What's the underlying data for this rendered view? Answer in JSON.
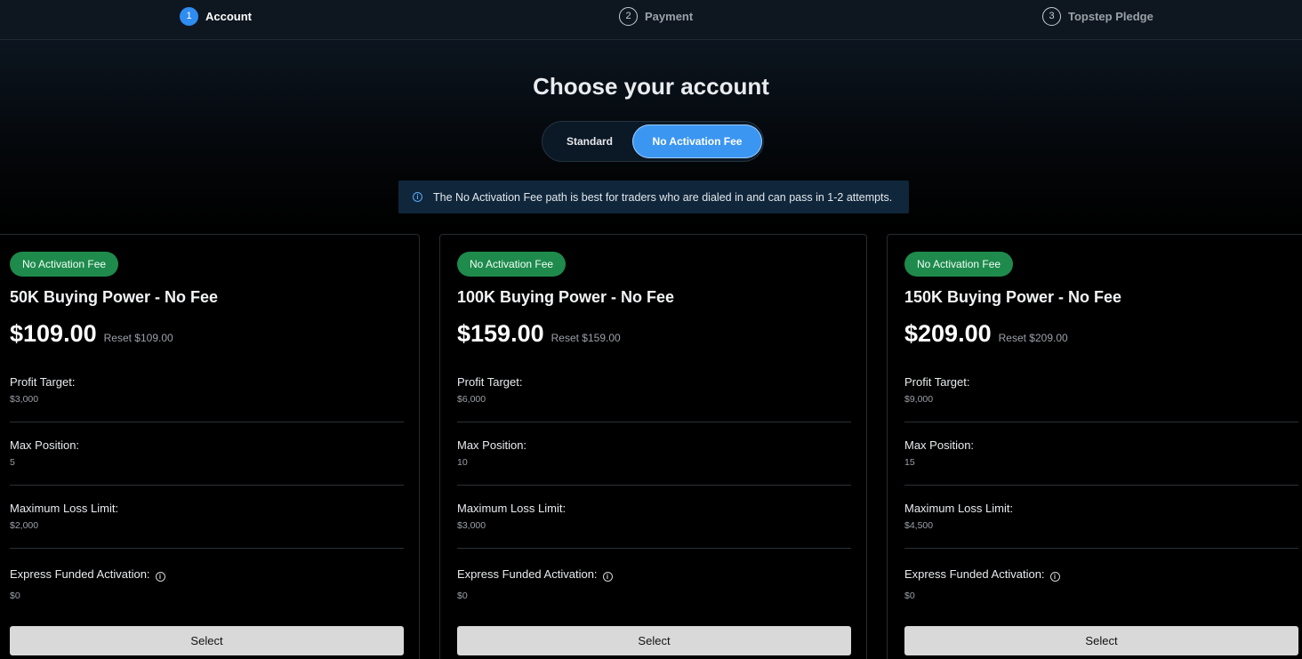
{
  "stepper": {
    "steps": [
      {
        "num": "1",
        "label": "Account",
        "active": true
      },
      {
        "num": "2",
        "label": "Payment",
        "active": false
      },
      {
        "num": "3",
        "label": "Topstep Pledge",
        "active": false
      }
    ]
  },
  "title": "Choose your account",
  "toggle": {
    "options": [
      "Standard",
      "No Activation Fee"
    ],
    "selected": "No Activation Fee"
  },
  "info": {
    "text": "The No Activation Fee path is best for traders who are dialed in and can pass in 1-2 attempts."
  },
  "colors": {
    "accent": "#3b96f2",
    "badge": "#1e8a4c",
    "button": "#d9d9d9"
  },
  "cards": [
    {
      "badge": "No Activation Fee",
      "name": "50K Buying Power - No Fee",
      "price": "$109.00",
      "reset": "Reset $109.00",
      "specs": [
        {
          "label": "Profit Target:",
          "value": "$3,000"
        },
        {
          "label": "Max Position:",
          "value": "5"
        },
        {
          "label": "Maximum Loss Limit:",
          "value": "$2,000"
        },
        {
          "label": "Express Funded Activation:",
          "value": "$0"
        }
      ],
      "button": "Select"
    },
    {
      "badge": "No Activation Fee",
      "name": "100K Buying Power - No Fee",
      "price": "$159.00",
      "reset": "Reset $159.00",
      "specs": [
        {
          "label": "Profit Target:",
          "value": "$6,000"
        },
        {
          "label": "Max Position:",
          "value": "10"
        },
        {
          "label": "Maximum Loss Limit:",
          "value": "$3,000"
        },
        {
          "label": "Express Funded Activation:",
          "value": "$0"
        }
      ],
      "button": "Select"
    },
    {
      "badge": "No Activation Fee",
      "name": "150K Buying Power - No Fee",
      "price": "$209.00",
      "reset": "Reset $209.00",
      "specs": [
        {
          "label": "Profit Target:",
          "value": "$9,000"
        },
        {
          "label": "Max Position:",
          "value": "15"
        },
        {
          "label": "Maximum Loss Limit:",
          "value": "$4,500"
        },
        {
          "label": "Express Funded Activation:",
          "value": "$0"
        }
      ],
      "button": "Select"
    }
  ]
}
